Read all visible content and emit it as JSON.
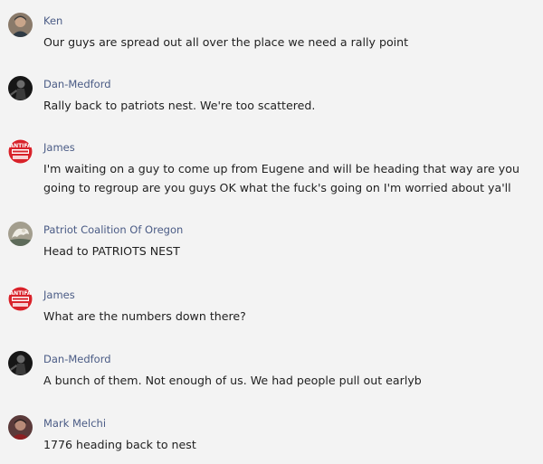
{
  "messages": [
    {
      "author": "Ken",
      "avatar": "ken-avatar-icon",
      "text": "Our guys are spread out all over the place we need a rally point"
    },
    {
      "author": "Dan-Medford",
      "avatar": "dan-medford-avatar-icon",
      "text": "Rally back to patriots nest. We're too scattered."
    },
    {
      "author": "James",
      "avatar": "james-avatar-icon",
      "text": "I'm waiting on a guy to come up from Eugene and will be heading that way are you going to regroup are you guys OK what the fuck's going on I'm worried about ya'll"
    },
    {
      "author": "Patriot Coalition Of Oregon",
      "avatar": "patriot-coalition-avatar-icon",
      "text": "Head to PATRIOTS NEST"
    },
    {
      "author": "James",
      "avatar": "james-avatar-icon",
      "text": "What are the numbers down there?"
    },
    {
      "author": "Dan-Medford",
      "avatar": "dan-medford-avatar-icon",
      "text": "A bunch of them. Not enough of us. We had people pull out earlyb"
    },
    {
      "author": "Mark Melchi",
      "avatar": "mark-melchi-avatar-icon",
      "text": "1776 heading back to nest"
    }
  ],
  "avatar_badge_text": "ANTIFA",
  "colors": {
    "background": "#f3f3f3",
    "author": "#4a5b85",
    "text": "#1f1f1f",
    "antifa_red": "#d8222a"
  }
}
